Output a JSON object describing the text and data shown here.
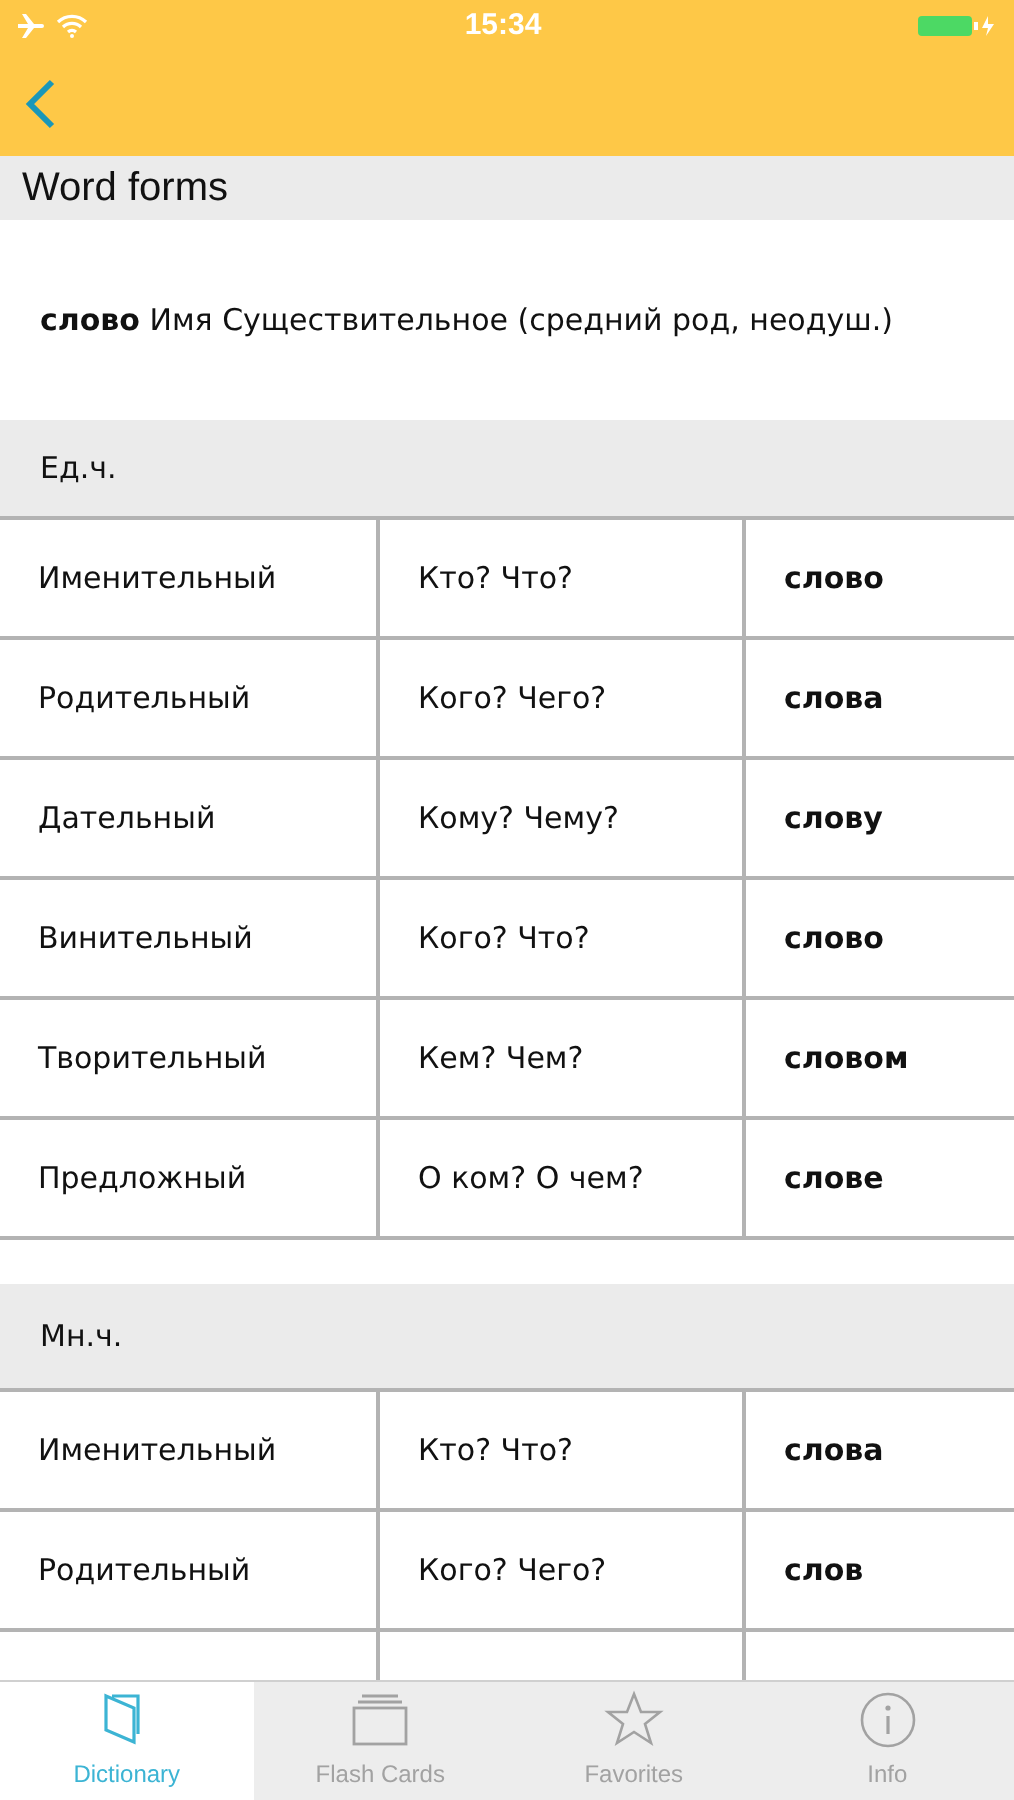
{
  "status_bar": {
    "time": "15:34"
  },
  "section_title": "Word forms",
  "entry": "**слово** Имя Существительное (средний род, неодуш.)",
  "tables": [
    {
      "heading": "Ед.ч.",
      "rows": [
        {
          "kind": "full",
          "case": "Именительный",
          "question": "Кто? Что?",
          "form": "слово"
        },
        {
          "kind": "full",
          "case": "Родительный",
          "question": "Кого? Чего?",
          "form": "слова"
        },
        {
          "kind": "full",
          "case": "Дательный",
          "question": "Кому? Чему?",
          "form": "слову"
        },
        {
          "kind": "full",
          "case": "Винительный",
          "question": "Кого? Что?",
          "form": "слово"
        },
        {
          "kind": "full",
          "case": "Творительный",
          "question": "Кем? Чем?",
          "form": "словом"
        },
        {
          "kind": "full",
          "case": "Предложный",
          "question": "О ком? О чем?",
          "form": "слове"
        }
      ]
    },
    {
      "heading": "Мн.ч.",
      "rows": [
        {
          "kind": "full",
          "case": "Именительный",
          "question": "Кто? Что?",
          "form": "слова"
        },
        {
          "kind": "full",
          "case": "Родительный",
          "question": "Кого? Чего?",
          "form": "слов"
        },
        {
          "kind": "covered"
        }
      ]
    }
  ],
  "tab_bar": [
    {
      "kind": "book",
      "label": "Dictionary",
      "selected": true
    },
    {
      "kind": "cards",
      "label": "Flash Cards",
      "selected": false
    },
    {
      "kind": "star",
      "label": "Favorites",
      "selected": false
    },
    {
      "kind": "info",
      "label": "Info",
      "selected": false
    }
  ]
}
